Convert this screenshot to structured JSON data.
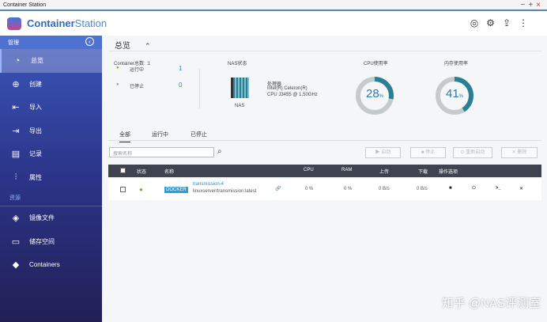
{
  "window": {
    "title": "Container Station",
    "controls": [
      "−",
      "+",
      "×"
    ]
  },
  "header": {
    "brand_bold": "Container",
    "brand_light": "Station",
    "icons": [
      "iot-icon",
      "gear-icon",
      "export-icon",
      "more-vert-icon"
    ]
  },
  "sidebar": {
    "section_manage": "管理",
    "items": [
      {
        "label": "总览",
        "icon": "dashboard-icon"
      },
      {
        "label": "创建",
        "icon": "plus-icon"
      },
      {
        "label": "导入",
        "icon": "import-icon"
      },
      {
        "label": "导出",
        "icon": "export-icon"
      },
      {
        "label": "记录",
        "icon": "document-icon"
      },
      {
        "label": "属性",
        "icon": "sliders-icon"
      }
    ],
    "section_resources": "资源",
    "resources": [
      {
        "label": "镜像文件",
        "icon": "layers-icon"
      },
      {
        "label": "储存空间",
        "icon": "storage-icon"
      },
      {
        "label": "Containers",
        "icon": "cube-icon"
      }
    ]
  },
  "overview": {
    "title": "总览",
    "container_total_label": "Container总数: :1",
    "running_label": "运行中",
    "running_count": "1",
    "stopped_label": "已停止",
    "stopped_count": "0",
    "nas_status_label": "NAS状态",
    "nas_label": "NAS",
    "processor_label": "处理器",
    "processor_line1": "Intel(R) Celeron(R)",
    "processor_line2": "CPU J3455 @ 1.50GHz",
    "cpu_label": "CPU使用率",
    "cpu_percent": 28,
    "mem_label": "内存使用率",
    "mem_percent": 41,
    "pct_sign": "%"
  },
  "tabs": [
    "全部",
    "运行中",
    "已停止"
  ],
  "toolbar": {
    "search_placeholder": "搜索名称",
    "start": "▶ 启动",
    "stop": "■ 停止",
    "restart": "⏻ 重新启动",
    "delete": "✕ 删除"
  },
  "table": {
    "headers": [
      "状态",
      "名称",
      "CPU",
      "RAM",
      "上传",
      "下载",
      "操作选项"
    ],
    "rows": [
      {
        "badge": "DOCKER",
        "name": "transmission-4",
        "image": "linuxserver/transmission:latest",
        "cpu": "0 %",
        "ram": "0 %",
        "upload": "0 B/s",
        "download": "0 B/s"
      }
    ]
  },
  "watermark": "知乎 @NAS评测室",
  "colors": {
    "accent": "#2c7bb0",
    "ring_track": "#c5cbcc",
    "ring_fill": "#2a7f94"
  }
}
